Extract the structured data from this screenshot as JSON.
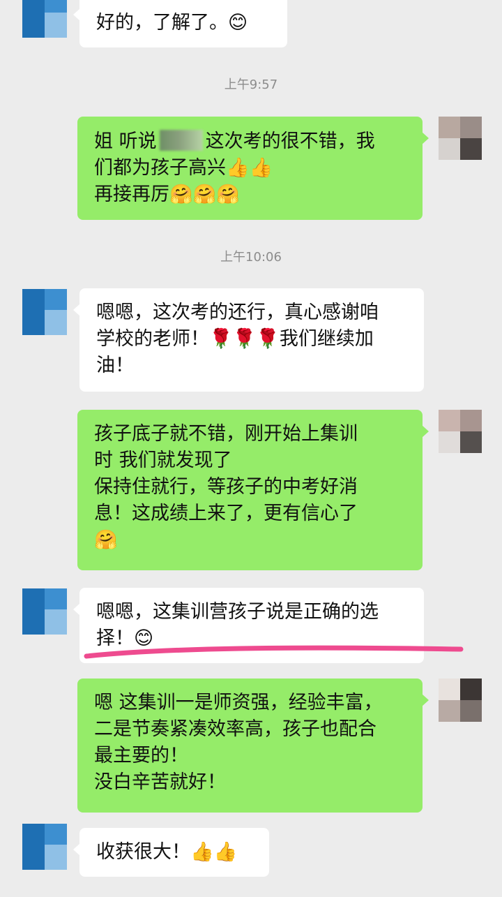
{
  "timestamps": {
    "t1": "上午9:57",
    "t2": "上午10:06"
  },
  "messages": [
    {
      "side": "in",
      "lines": [
        "好的，了解了。😊"
      ]
    },
    {
      "side": "out",
      "lines": [
        "姐  听说",
        "这次考的很不错，我",
        "们都为孩子高兴👍👍",
        "再接再厉🤗🤗🤗"
      ]
    },
    {
      "side": "in",
      "lines": [
        "嗯嗯，这次考的还行，真心感谢咱",
        "学校的老师！🌹🌹🌹我们继续加",
        "油！"
      ]
    },
    {
      "side": "out",
      "lines": [
        "孩子底子就不错，刚开始上集训",
        "时 我们就发现了",
        "保持住就行，等孩子的中考好消",
        "息！这成绩上来了，更有信心了",
        "🤗"
      ]
    },
    {
      "side": "in",
      "lines": [
        "嗯嗯，这集训营孩子说是正确的选",
        "择！😊"
      ]
    },
    {
      "side": "out",
      "lines": [
        "嗯 这集训一是师资强，经验丰富，",
        "二是节奏紧凑效率高，孩子也配合",
        "最主要的！",
        "没白辛苦就好！"
      ]
    },
    {
      "side": "in",
      "lines": [
        "收获很大！👍👍"
      ]
    }
  ],
  "colors": {
    "chat_background": "#ececec",
    "incoming_bubble": "#ffffff",
    "outgoing_bubble": "#95ec69",
    "highlight_stroke": "#ee4b8f"
  }
}
